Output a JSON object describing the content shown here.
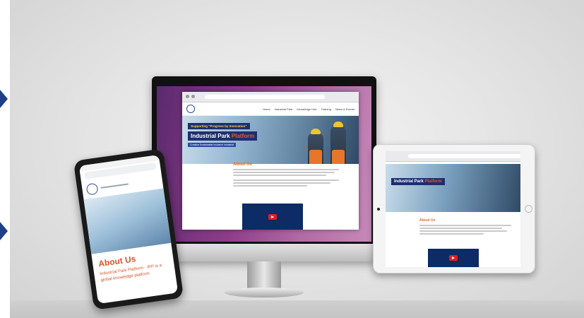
{
  "scene": {
    "description_free": true,
    "colors": {
      "brand_navy": "#1d2f6b",
      "accent_orange": "#e36a2c",
      "purple_bg": "#8e3c88"
    }
  },
  "site": {
    "nav": [
      "Home",
      "Industrial Park",
      "Knowledge Hub",
      "Training",
      "News & Events"
    ],
    "hero_tag": "Supporting \"Progress by Innovation\"",
    "hero_title_main": "Industrial Park",
    "hero_title_highlight": "Platform",
    "hero_sub": "Creative Sustainable Inclusive Industrial",
    "about_heading": "About Us",
    "about_lead": "Industrial Park Platform - IPP is a global knowledge platform"
  },
  "icons": [
    "left-arrow-icon",
    "youtube-play-icon",
    "logo-icon"
  ]
}
